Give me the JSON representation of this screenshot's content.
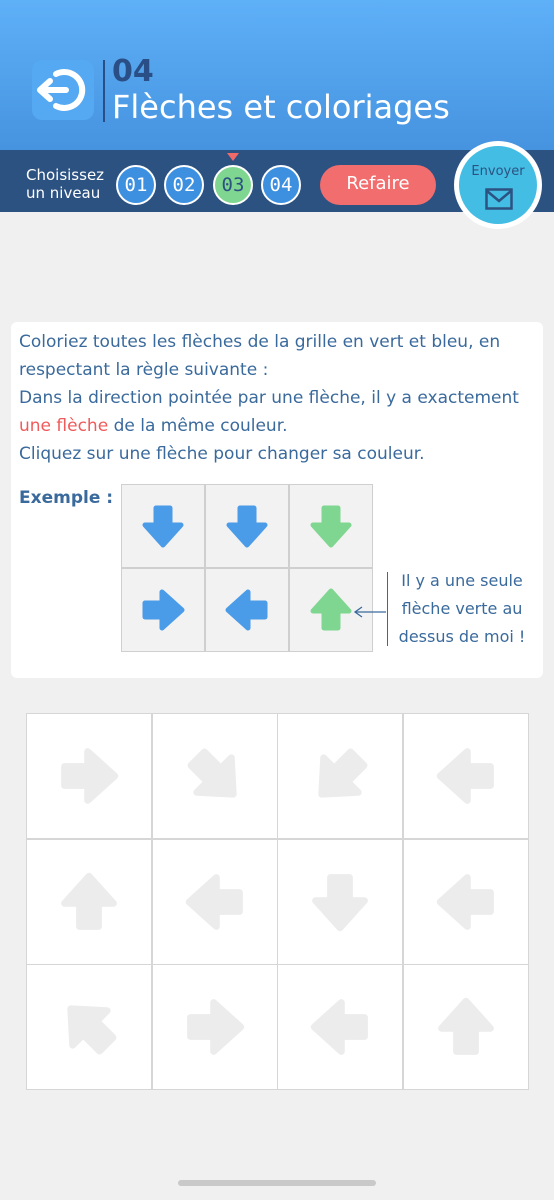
{
  "header": {
    "number": "04",
    "title": "Flèches et coloriages"
  },
  "levels": {
    "label_line1": "Choisissez",
    "label_line2": "un niveau",
    "items": [
      "01",
      "02",
      "03",
      "04"
    ],
    "selected": "03"
  },
  "actions": {
    "redo_label": "Refaire",
    "send_label": "Envoyer"
  },
  "colors": {
    "header": "#5eb0f7",
    "bar": "#2c5282",
    "blue_arrow": "#4a9be8",
    "green_arrow": "#7fd690",
    "grey_arrow": "#ececec",
    "redo": "#f26d6d",
    "send": "#43bde3"
  },
  "instructions": {
    "line1": "Coloriez toutes les flèches de la grille en vert et bleu, en",
    "line2": "respectant la règle suivante :",
    "line3": "Dans la direction pointée par une flèche, il y a exactement",
    "highlight": "une flèche",
    "line4_rest": " de la même couleur.",
    "line5": "Cliquez sur une flèche pour changer sa couleur."
  },
  "example": {
    "label": "Exemple :",
    "cells": [
      {
        "dir": "down",
        "color": "blue"
      },
      {
        "dir": "down",
        "color": "blue"
      },
      {
        "dir": "down",
        "color": "green"
      },
      {
        "dir": "right",
        "color": "blue"
      },
      {
        "dir": "left",
        "color": "blue"
      },
      {
        "dir": "up",
        "color": "green"
      }
    ],
    "callout_line1": "Il y a une seule",
    "callout_line2": "flèche verte au",
    "callout_line3": "dessus de moi !"
  },
  "grid": {
    "rows": 3,
    "cols": 4,
    "cells": [
      {
        "dir": "right",
        "color": "grey"
      },
      {
        "dir": "down-right",
        "color": "grey"
      },
      {
        "dir": "down-left",
        "color": "grey"
      },
      {
        "dir": "left",
        "color": "grey"
      },
      {
        "dir": "up",
        "color": "grey"
      },
      {
        "dir": "left",
        "color": "grey"
      },
      {
        "dir": "down",
        "color": "grey"
      },
      {
        "dir": "left",
        "color": "grey"
      },
      {
        "dir": "up-left",
        "color": "grey"
      },
      {
        "dir": "right",
        "color": "grey"
      },
      {
        "dir": "left",
        "color": "grey"
      },
      {
        "dir": "up",
        "color": "grey"
      }
    ]
  }
}
